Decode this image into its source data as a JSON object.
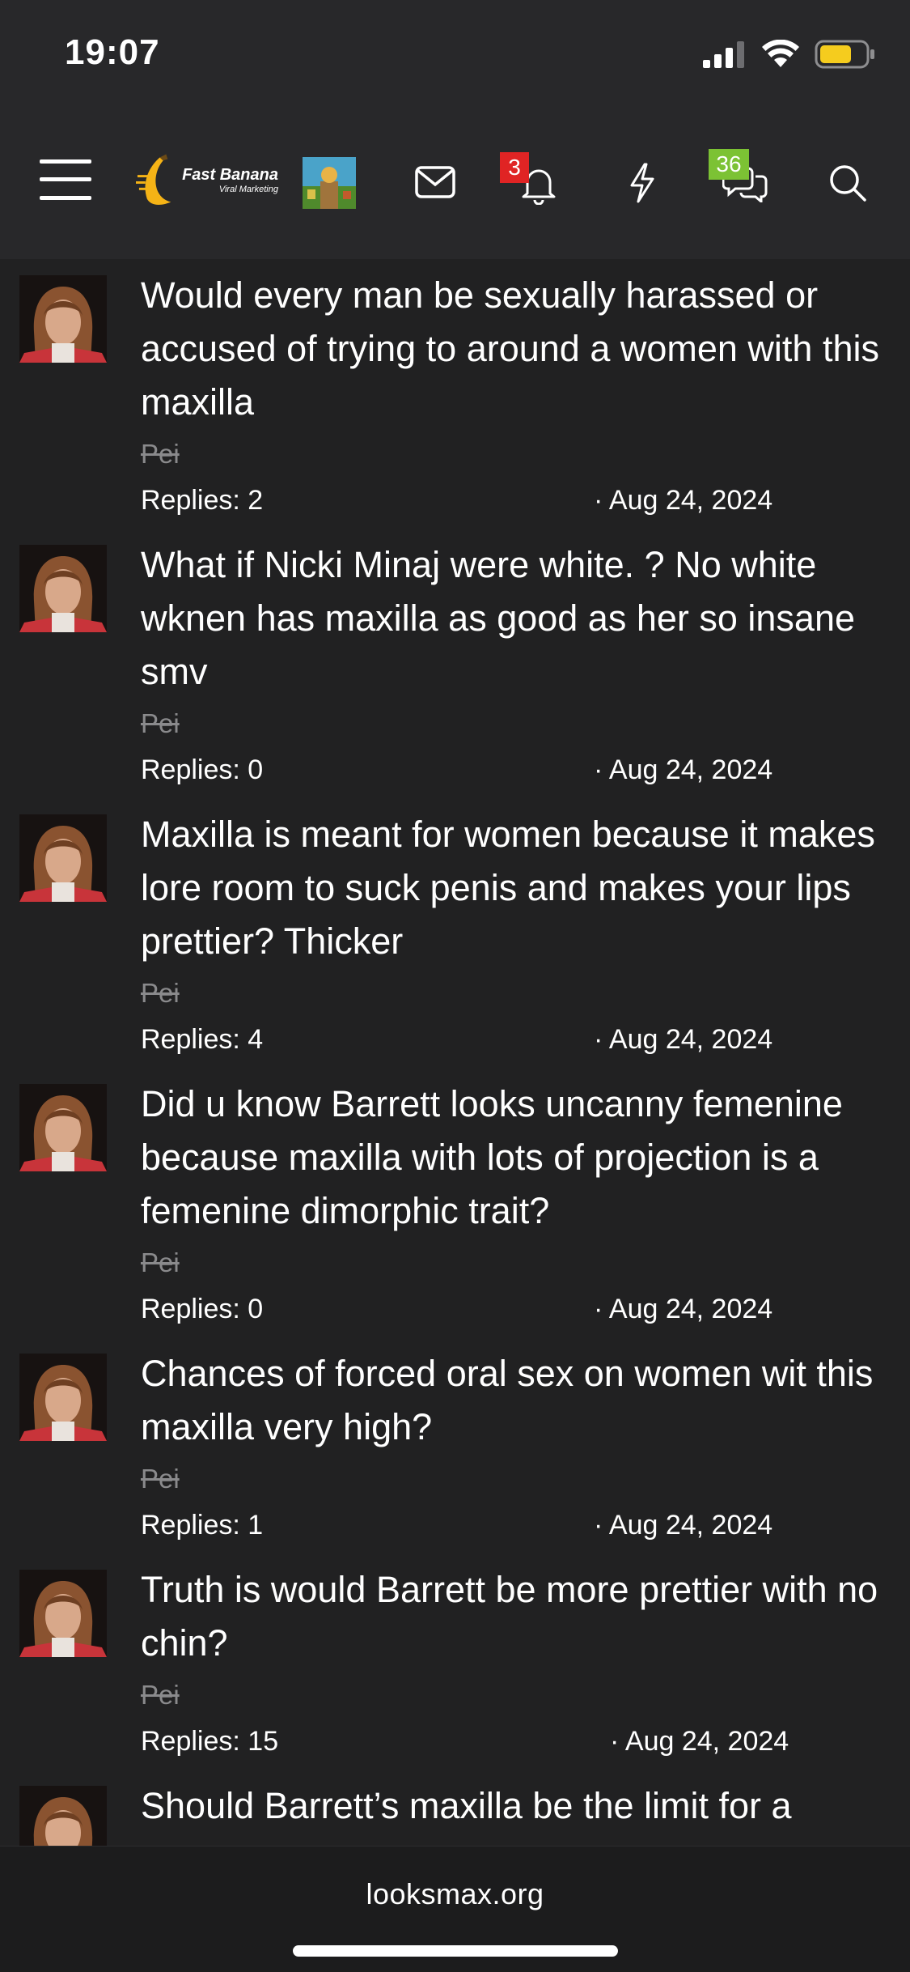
{
  "status_bar": {
    "time": "19:07",
    "battery_color": "#f5cc1e"
  },
  "nav": {
    "logo_text": "Fast Banana",
    "logo_subtext": "Viral Marketing",
    "notifications_badge": "3",
    "conversations_badge": "36",
    "badge_red": "#e02424",
    "badge_green": "#7cc234"
  },
  "threads": [
    {
      "title": "Would every man be sexually harassed or accused of trying to around a women with this maxilla",
      "author": "Pei",
      "replies": "Replies: 2",
      "date": "· Aug 24, 2024"
    },
    {
      "title": "What if Nicki Minaj were white. ? No white wknen has maxilla as good as her so insane smv",
      "author": "Pei",
      "replies": "Replies: 0",
      "date": "· Aug 24, 2024"
    },
    {
      "title": "Maxilla is meant for women because it makes lore room to suck penis and makes your lips prettier? Thicker",
      "author": "Pei",
      "replies": "Replies: 4",
      "date": "· Aug 24, 2024"
    },
    {
      "title": "Did u know Barrett looks uncanny femenine because maxilla with lots of projection is a femenine dimorphic trait?",
      "author": "Pei",
      "replies": "Replies: 0",
      "date": "· Aug 24, 2024"
    },
    {
      "title": "Chances of forced oral sex on women wit this maxilla very high?",
      "author": "Pei",
      "replies": "Replies: 1",
      "date": "· Aug 24, 2024"
    },
    {
      "title": "Truth is would Barrett be more prettier with no chin?",
      "author": "Pei",
      "replies": "Replies: 15",
      "date": "· Aug 24, 2024"
    },
    {
      "title": "Should Barrett’s maxilla be the limit for a",
      "author": "",
      "replies": "",
      "date": ""
    }
  ],
  "browser": {
    "url": "looksmax.org"
  }
}
